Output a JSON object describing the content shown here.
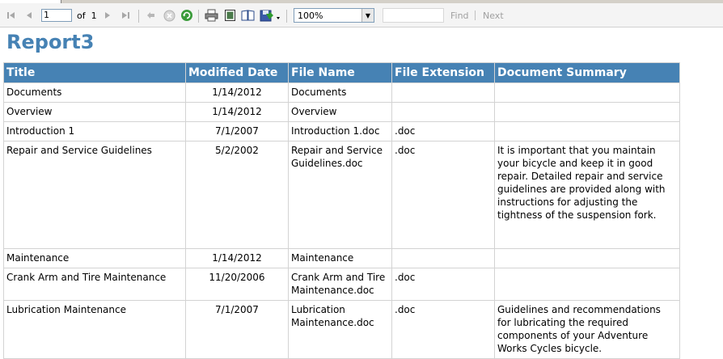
{
  "toolbar": {
    "page_value": "1",
    "of_label": "of",
    "total_pages": "1",
    "zoom_value": "100%",
    "find_label": "Find",
    "next_label": "Next"
  },
  "report": {
    "title": "Report3",
    "columns": [
      "Title",
      "Modified Date",
      "File Name",
      "File Extension",
      "Document Summary"
    ],
    "rows": [
      {
        "title": "Documents",
        "date": "1/14/2012",
        "file": "Documents",
        "ext": "",
        "summary": ""
      },
      {
        "title": "Overview",
        "date": "1/14/2012",
        "file": "Overview",
        "ext": "",
        "summary": ""
      },
      {
        "title": "Introduction 1",
        "date": "7/1/2007",
        "file": "Introduction 1.doc",
        "ext": ".doc",
        "summary": ""
      },
      {
        "title": "Repair and Service Guidelines",
        "date": "5/2/2002",
        "file": "Repair and Service Guidelines.doc",
        "ext": ".doc",
        "summary": "It is important that you maintain your bicycle and keep it in good repair. Detailed repair and service guidelines are provided along with instructions for adjusting the tightness of the suspension fork."
      },
      {
        "title": "Maintenance",
        "date": "1/14/2012",
        "file": "Maintenance",
        "ext": "",
        "summary": ""
      },
      {
        "title": "Crank Arm and Tire Maintenance",
        "date": "11/20/2006",
        "file": "Crank Arm and Tire Maintenance.doc",
        "ext": ".doc",
        "summary": ""
      },
      {
        "title": "Lubrication Maintenance",
        "date": "7/1/2007",
        "file": "Lubrication Maintenance.doc",
        "ext": ".doc",
        "summary": "Guidelines and recommendations for lubricating the required components of your Adventure Works Cycles bicycle."
      }
    ]
  }
}
